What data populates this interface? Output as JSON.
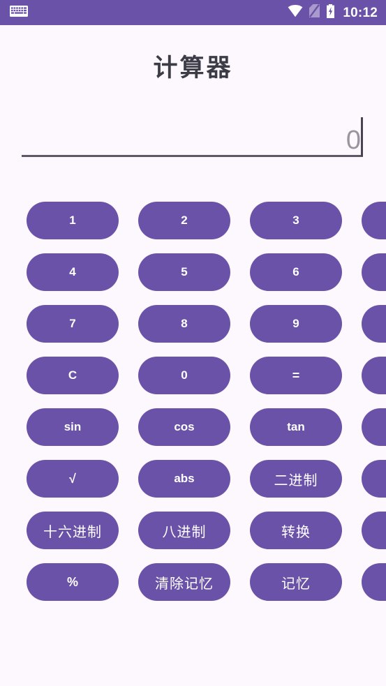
{
  "status_bar": {
    "background_color": "#6a52a8",
    "keyboard_icon": "keyboard-icon",
    "wifi_icon": "wifi-icon",
    "sim_icon": "sim-card-slash-icon",
    "battery_icon": "battery-charging-icon",
    "time": "10:12"
  },
  "header": {
    "title": "计算器"
  },
  "display": {
    "value": "",
    "placeholder": "0",
    "caret": true,
    "underline_color": "#5f5668"
  },
  "theme": {
    "page_background": "#fdf8fd",
    "button_color": "#6a52a8",
    "button_text_color": "#ffffff",
    "title_color": "#3c3c46",
    "placeholder_color": "#9a949f"
  },
  "keypad": {
    "rows": [
      {
        "keys": [
          {
            "label": "1",
            "name": "key-1",
            "style": "num"
          },
          {
            "label": "2",
            "name": "key-2",
            "style": "num"
          },
          {
            "label": "3",
            "name": "key-3",
            "style": "num"
          },
          {
            "label": "",
            "name": "key-row1-overflow",
            "style": "num"
          }
        ]
      },
      {
        "keys": [
          {
            "label": "4",
            "name": "key-4",
            "style": "num"
          },
          {
            "label": "5",
            "name": "key-5",
            "style": "num"
          },
          {
            "label": "6",
            "name": "key-6",
            "style": "num"
          },
          {
            "label": "",
            "name": "key-row2-overflow",
            "style": "num"
          }
        ]
      },
      {
        "keys": [
          {
            "label": "7",
            "name": "key-7",
            "style": "num"
          },
          {
            "label": "8",
            "name": "key-8",
            "style": "num"
          },
          {
            "label": "9",
            "name": "key-9",
            "style": "num"
          },
          {
            "label": "",
            "name": "key-row3-overflow",
            "style": "num"
          }
        ]
      },
      {
        "keys": [
          {
            "label": "C",
            "name": "key-clear",
            "style": "num"
          },
          {
            "label": "0",
            "name": "key-0",
            "style": "num"
          },
          {
            "label": "=",
            "name": "key-equals",
            "style": "sym"
          },
          {
            "label": "",
            "name": "key-row4-overflow",
            "style": "num"
          }
        ]
      },
      {
        "keys": [
          {
            "label": "sin",
            "name": "key-sin",
            "style": "num"
          },
          {
            "label": "cos",
            "name": "key-cos",
            "style": "num"
          },
          {
            "label": "tan",
            "name": "key-tan",
            "style": "num"
          },
          {
            "label": "",
            "name": "key-row5-overflow",
            "style": "num"
          }
        ]
      },
      {
        "keys": [
          {
            "label": "√",
            "name": "key-sqrt",
            "style": "sym"
          },
          {
            "label": "abs",
            "name": "key-abs",
            "style": "num"
          },
          {
            "label": "二进制",
            "name": "key-binary",
            "style": "cjk"
          },
          {
            "label": "",
            "name": "key-row6-overflow",
            "style": "num"
          }
        ]
      },
      {
        "keys": [
          {
            "label": "十六进制",
            "name": "key-hexadecimal",
            "style": "cjk"
          },
          {
            "label": "八进制",
            "name": "key-octal",
            "style": "cjk"
          },
          {
            "label": "转换",
            "name": "key-convert",
            "style": "cjk"
          },
          {
            "label": "",
            "name": "key-row7-overflow",
            "style": "num"
          }
        ]
      },
      {
        "keys": [
          {
            "label": "%",
            "name": "key-percent",
            "style": "sym"
          },
          {
            "label": "清除记忆",
            "name": "key-memory-clear",
            "style": "cjk"
          },
          {
            "label": "记忆",
            "name": "key-memory-recall",
            "style": "cjk"
          },
          {
            "label": "",
            "name": "key-row8-overflow",
            "style": "num"
          }
        ]
      }
    ]
  }
}
